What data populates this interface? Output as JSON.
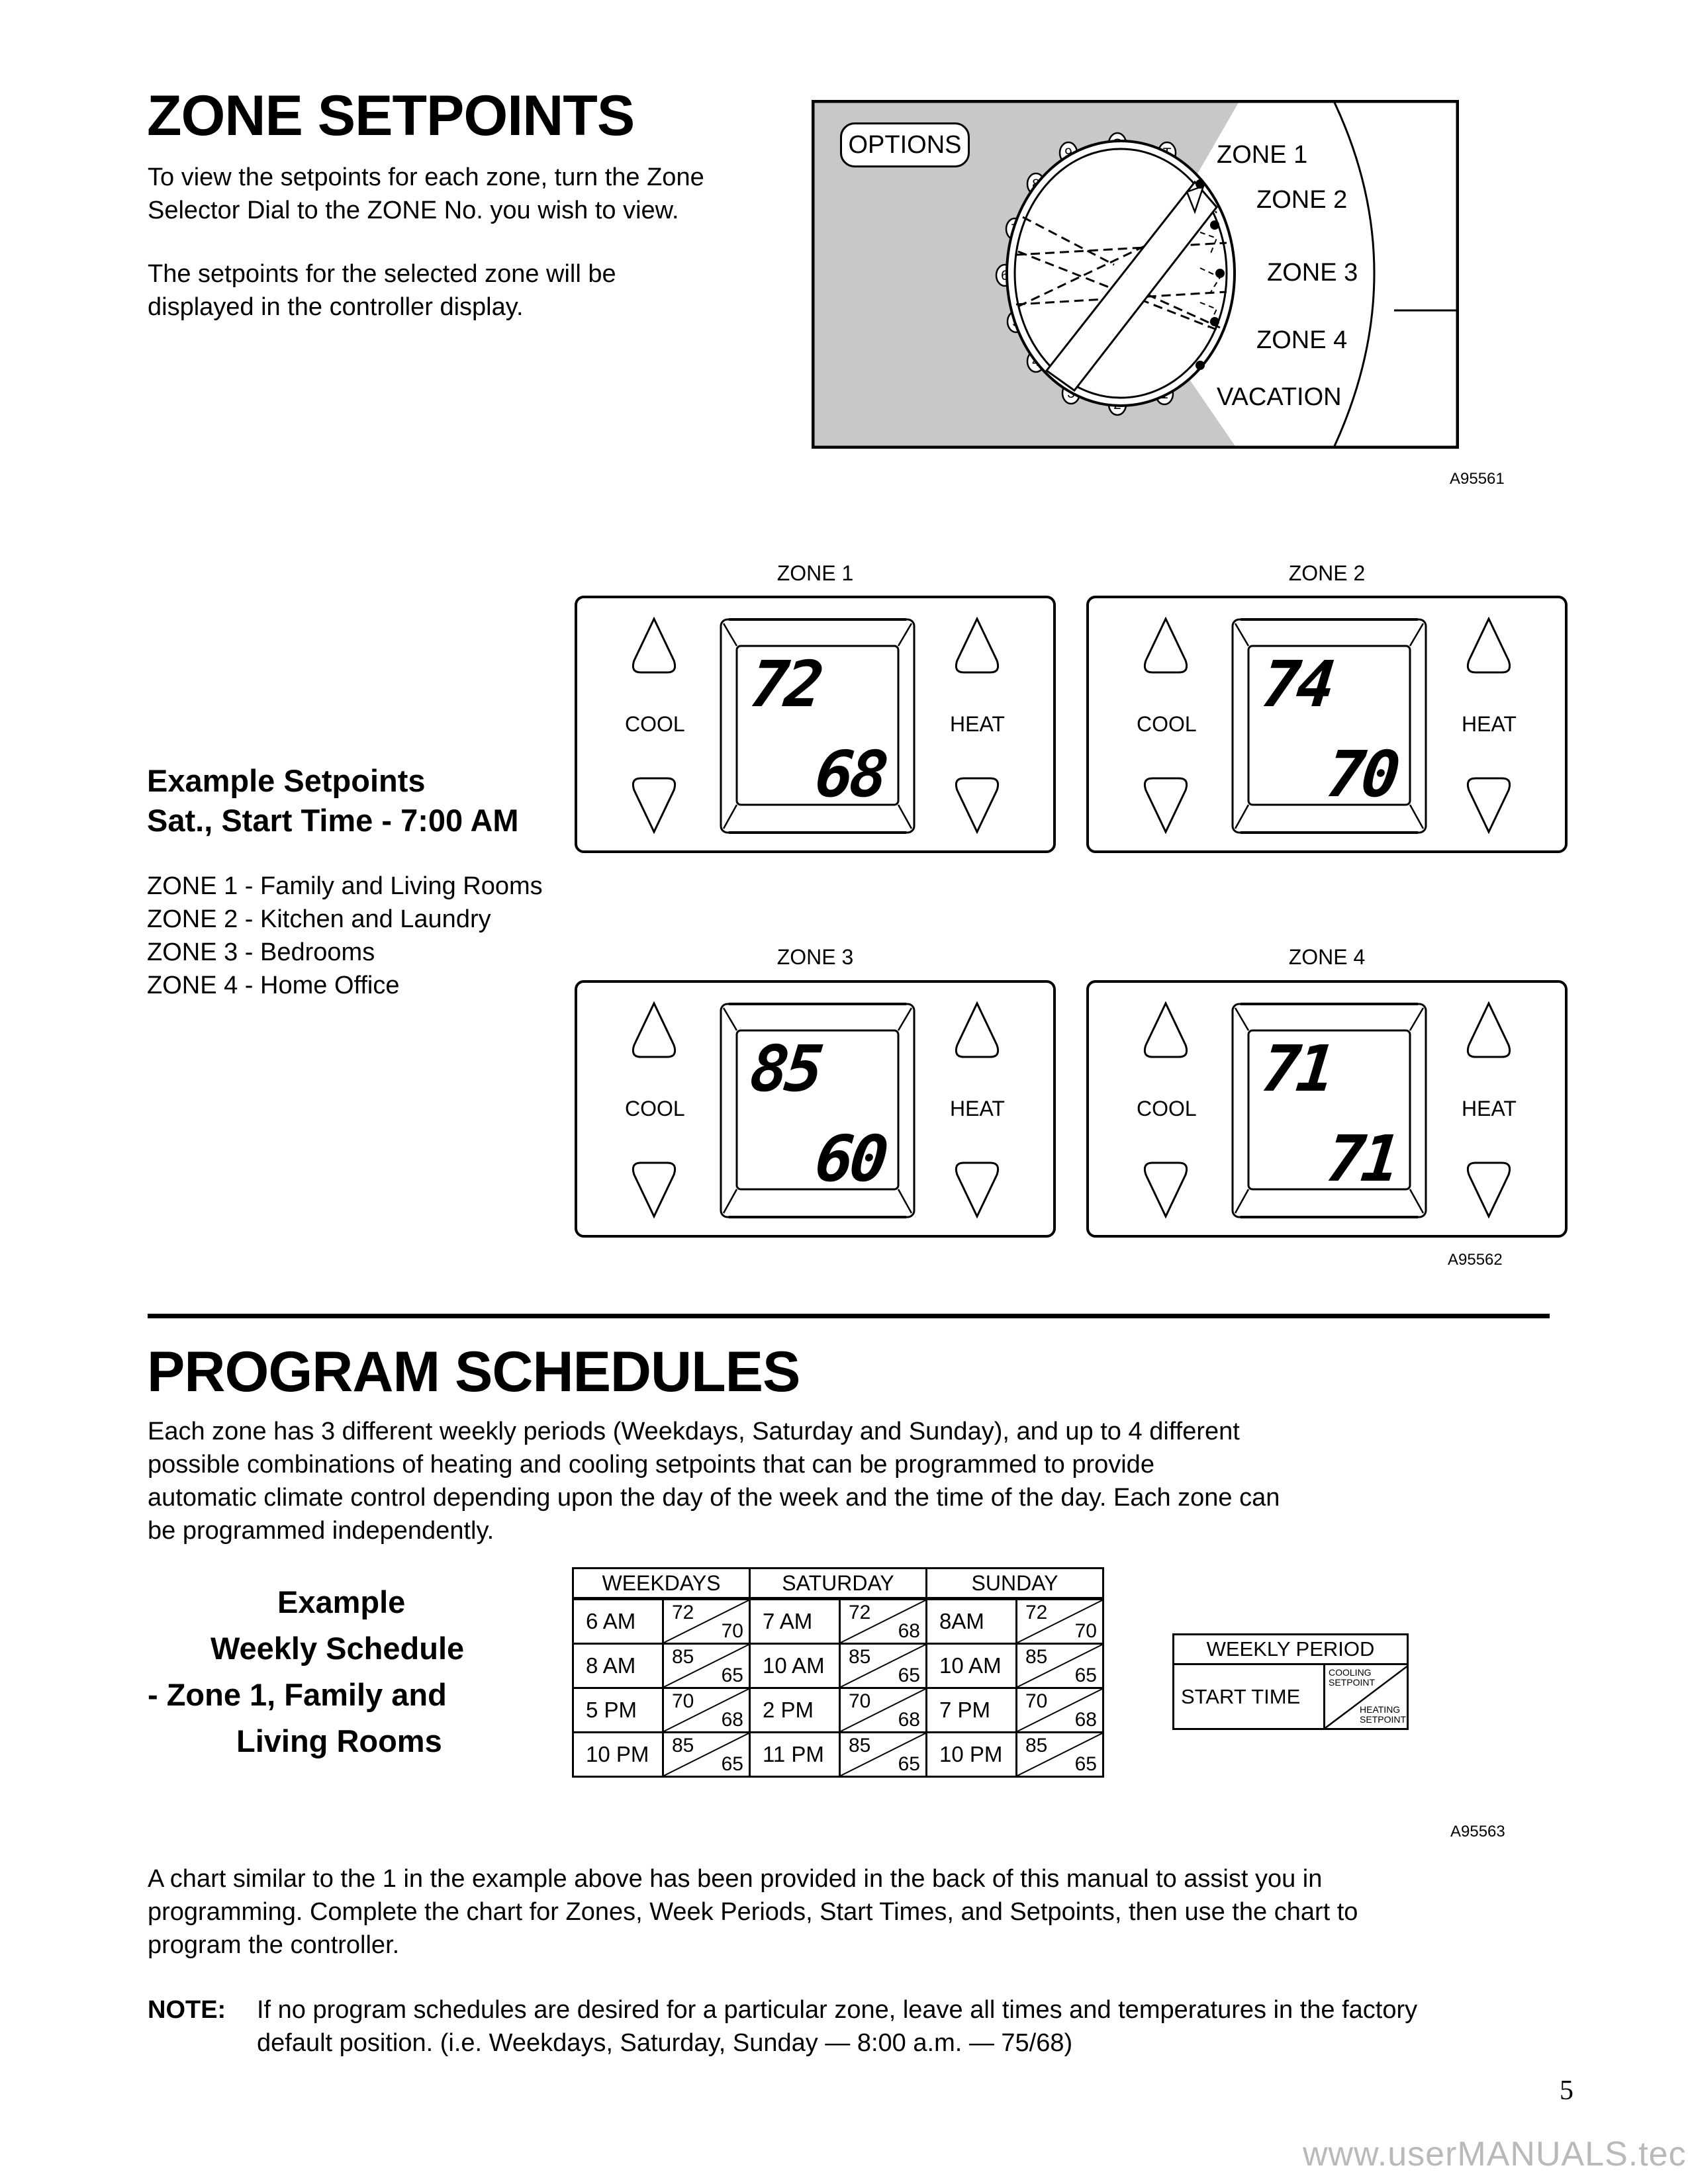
{
  "zone_setpoints": {
    "title": "ZONE SETPOINTS",
    "para1": [
      "To view the setpoints for each zone, turn the Zone",
      "Selector Dial to the ZONE No. you wish to view."
    ],
    "para2": [
      "The setpoints for the selected zone will be",
      "displayed in the controller display."
    ]
  },
  "dial_figure": {
    "options_label": "OPTIONS",
    "dial_positions": [
      "S",
      "T",
      "1",
      "2",
      "3",
      "4",
      "5",
      "6",
      "7",
      "8",
      "9"
    ],
    "selector_labels": [
      "ZONE 1",
      "ZONE 2",
      "ZONE 3",
      "ZONE 4",
      "VACATION"
    ],
    "figure_id": "A95561"
  },
  "example_setpoints": {
    "heading_line1": "Example Setpoints",
    "heading_line2": "Sat., Start Time - 7:00 AM",
    "zone_list": [
      "ZONE 1 - Family and Living Rooms",
      "ZONE 2 - Kitchen and Laundry",
      "ZONE 3 - Bedrooms",
      "ZONE 4 - Home Office"
    ]
  },
  "displays": {
    "cool_label": "COOL",
    "heat_label": "HEAT",
    "zones": [
      {
        "label": "ZONE 1",
        "cool": "72",
        "heat": "68"
      },
      {
        "label": "ZONE 2",
        "cool": "74",
        "heat": "70"
      },
      {
        "label": "ZONE 3",
        "cool": "85",
        "heat": "60"
      },
      {
        "label": "ZONE 4",
        "cool": "71",
        "heat": "71"
      }
    ],
    "figure_id": "A95562"
  },
  "program_schedules": {
    "title": "PROGRAM SCHEDULES",
    "intro": [
      "Each zone has 3 different weekly periods (Weekdays, Saturday and Sunday), and up to 4 different",
      "possible combinations of heating and cooling setpoints that can be programmed to provide",
      "automatic climate control depending upon the day of the week and the time of the day. Each zone can",
      "be programmed independently."
    ],
    "example_caption": [
      "Example",
      "Weekly Schedule",
      "- Zone 1, Family and",
      "Living Rooms"
    ],
    "schedule_table": {
      "headers": [
        "WEEKDAYS",
        "SATURDAY",
        "SUNDAY"
      ],
      "rows": [
        [
          {
            "time": "6 AM",
            "cool": "72",
            "heat": "70"
          },
          {
            "time": "7 AM",
            "cool": "72",
            "heat": "68"
          },
          {
            "time": "8AM",
            "cool": "72",
            "heat": "70"
          }
        ],
        [
          {
            "time": "8 AM",
            "cool": "85",
            "heat": "65"
          },
          {
            "time": "10 AM",
            "cool": "85",
            "heat": "65"
          },
          {
            "time": "10 AM",
            "cool": "85",
            "heat": "65"
          }
        ],
        [
          {
            "time": "5 PM",
            "cool": "70",
            "heat": "68"
          },
          {
            "time": "2 PM",
            "cool": "70",
            "heat": "68"
          },
          {
            "time": "7 PM",
            "cool": "70",
            "heat": "68"
          }
        ],
        [
          {
            "time": "10 PM",
            "cool": "85",
            "heat": "65"
          },
          {
            "time": "11 PM",
            "cool": "85",
            "heat": "65"
          },
          {
            "time": "10 PM",
            "cool": "85",
            "heat": "65"
          }
        ]
      ]
    },
    "legend": {
      "title": "WEEKLY PERIOD",
      "start_time": "START TIME",
      "cooling_1": "COOLING",
      "cooling_2": "SETPOINT",
      "heating_1": "HEATING",
      "heating_2": "SETPOINT"
    },
    "figure_id": "A95563",
    "chart_note": [
      "A chart similar to the 1 in the example above has been provided in the back of this manual to assist you in",
      "programming. Complete the chart for Zones, Week Periods, Start Times, and Setpoints, then use the chart to",
      "program the controller."
    ],
    "note_label": "NOTE:",
    "note_text": [
      "If no program schedules are desired for a particular zone, leave all times and temperatures in the factory",
      "default position. (i.e. Weekdays, Saturday, Sunday — 8:00 a.m. — 75/68)"
    ]
  },
  "page_number": "5",
  "watermark": "www.userMANUALS.tech"
}
